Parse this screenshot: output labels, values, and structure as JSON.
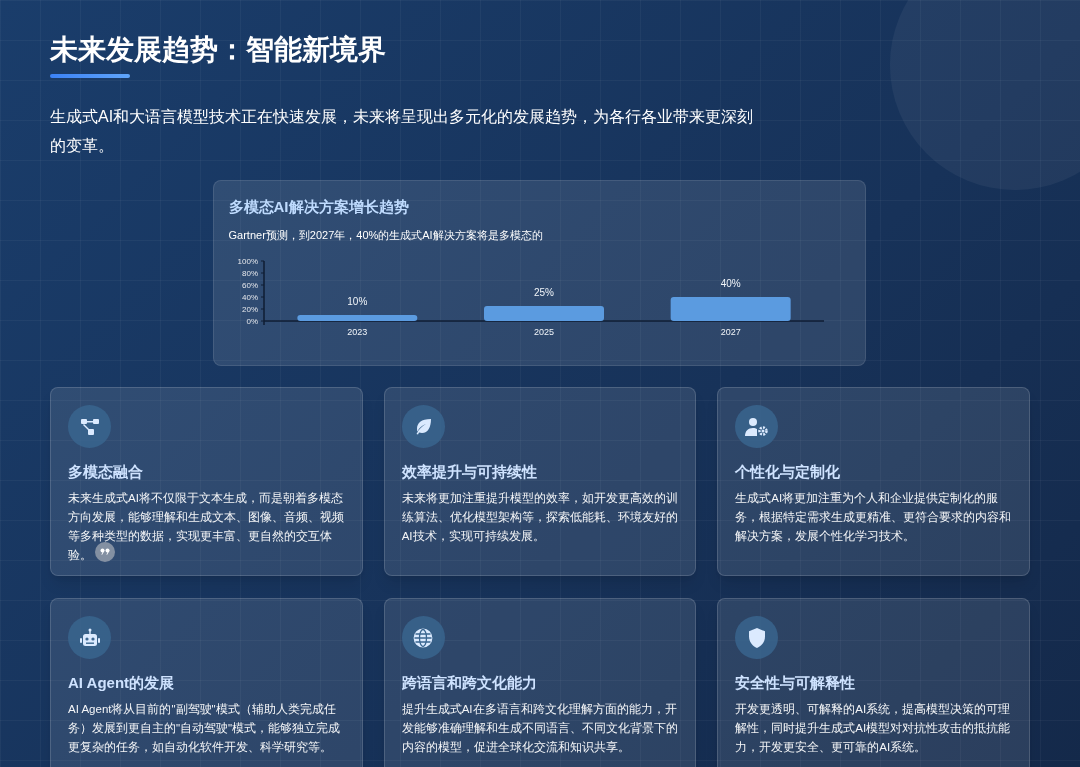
{
  "title": "未来发展趋势：智能新境界",
  "intro": "生成式AI和大语言模型技术正在快速发展，未来将呈现出多元化的发展趋势，为各行各业带来更深刻的变革。",
  "chart_card": {
    "title": "多模态AI解决方案增长趋势",
    "subtitle": "Gartner预测，到2027年，40%的生成式AI解决方案将是多模态的",
    "chart_data": {
      "type": "bar",
      "categories": [
        "2023",
        "2025",
        "2027"
      ],
      "series": [
        {
          "color": "#5b9be0",
          "values": [
            10,
            25,
            40
          ]
        }
      ],
      "ylim": [
        0,
        100
      ],
      "yticks": [
        {
          "value": 0,
          "label": "0%"
        },
        {
          "value": 20,
          "label": "20%"
        },
        {
          "value": 40,
          "label": "40%"
        },
        {
          "value": 60,
          "label": "60%"
        },
        {
          "value": 80,
          "label": "80%"
        },
        {
          "value": 100,
          "label": "100%"
        }
      ],
      "value_labels": [
        "10%",
        "25%",
        "40%"
      ]
    }
  },
  "cards": [
    {
      "kind": "nodes",
      "title": "多模态融合",
      "text": "未来生成式AI将不仅限于文本生成，而是朝着多模态方向发展，能够理解和生成文本、图像、音频、视频等多种类型的数据，实现更丰富、更自然的交互体验。",
      "quote_mark": true
    },
    {
      "kind": "leaf",
      "title": "效率提升与可持续性",
      "text": "未来将更加注重提升模型的效率，如开发更高效的训练算法、优化模型架构等，探索低能耗、环境友好的AI技术，实现可持续发展。",
      "quote_mark": false
    },
    {
      "kind": "user-gear",
      "title": "个性化与定制化",
      "text": "生成式AI将更加注重为个人和企业提供定制化的服务，根据特定需求生成更精准、更符合要求的内容和解决方案，发展个性化学习技术。",
      "quote_mark": false
    },
    {
      "kind": "robot",
      "title": "AI Agent的发展",
      "text": "AI Agent将从目前的\"副驾驶\"模式（辅助人类完成任务）发展到更自主的\"自动驾驶\"模式，能够独立完成更复杂的任务，如自动化软件开发、科学研究等。",
      "quote_mark": false
    },
    {
      "kind": "globe",
      "title": "跨语言和跨文化能力",
      "text": "提升生成式AI在多语言和跨文化理解方面的能力，开发能够准确理解和生成不同语言、不同文化背景下的内容的模型，促进全球化交流和知识共享。",
      "quote_mark": false
    },
    {
      "kind": "shield",
      "title": "安全性与可解释性",
      "text": "开发更透明、可解释的AI系统，提高模型决策的可理解性，同时提升生成式AI模型对对抗性攻击的抵抗能力，开发更安全、更可靠的AI系统。",
      "quote_mark": false
    }
  ]
}
